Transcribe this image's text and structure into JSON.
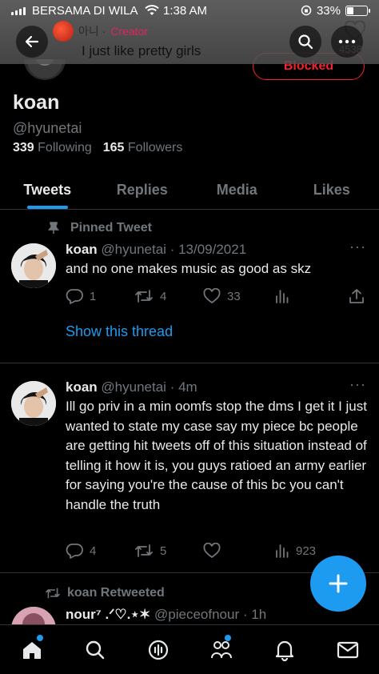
{
  "status_bar": {
    "carrier": "BERSAMA DI WILA",
    "time": "1:38 AM",
    "battery": "33%",
    "battery_level": 0.33
  },
  "header": {
    "song_artist": "아니 ·",
    "song_role": "Creator",
    "song_title": "I just like pretty girls",
    "like_count": "4538"
  },
  "profile": {
    "blocked_label": "Blocked",
    "name": "koan",
    "handle": "@hyunetai",
    "following_count": "339",
    "following_label": "Following",
    "followers_count": "165",
    "followers_label": "Followers"
  },
  "tabs": [
    {
      "label": "Tweets",
      "active": true
    },
    {
      "label": "Replies",
      "active": false
    },
    {
      "label": "Media",
      "active": false
    },
    {
      "label": "Likes",
      "active": false
    }
  ],
  "tweets": [
    {
      "context": "Pinned Tweet",
      "name": "koan",
      "handle": "@hyunetai",
      "time": "· 13/09/2021",
      "text": "and no one makes music as good as skz",
      "replies": "1",
      "retweets": "4",
      "likes": "33",
      "show_thread": "Show this thread"
    },
    {
      "name": "koan",
      "handle": "@hyunetai",
      "time": "· 4m",
      "text": "Ill go priv in a min oomfs stop the dms I get it I just wanted to state my case say my piece bc people are getting hit tweets off of this situation instead of telling it how it is, you guys ratioed an army earlier for saying you're the cause of this bc you can't handle the truth",
      "replies": "4",
      "retweets": "5",
      "likes": "",
      "views": "923"
    },
    {
      "context": "koan Retweeted",
      "name": "nour⁷ .ᐟ♡.⋆✶",
      "handle": "@pieceofnour",
      "time": "· 1h"
    }
  ],
  "colors": {
    "accent": "#1d9bf0",
    "muted": "#71767b",
    "blocked": "#f4212e",
    "background": "#000000"
  },
  "icons": [
    "back-arrow-icon",
    "search-icon",
    "more-icon",
    "pin-icon",
    "reply-icon",
    "retweet-icon",
    "like-icon",
    "views-icon",
    "share-icon",
    "compose-icon",
    "home-icon",
    "spaces-icon",
    "communities-icon",
    "notifications-icon",
    "messages-icon"
  ]
}
